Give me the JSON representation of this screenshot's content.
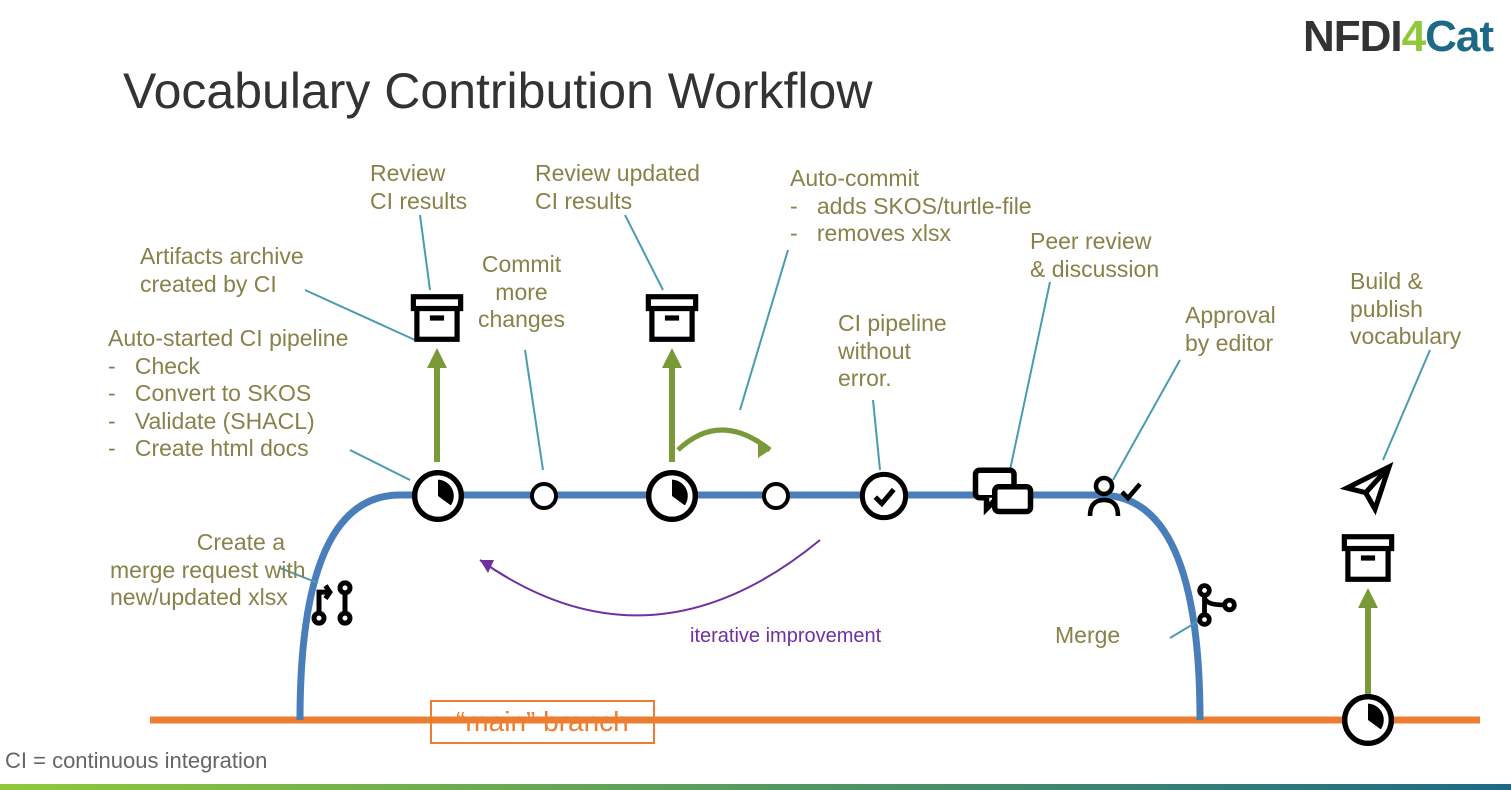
{
  "title": "Vocabulary Contribution Workflow",
  "logo": {
    "part1": "NFDI",
    "part2": "4",
    "part3": "Cat"
  },
  "labels": {
    "merge_request": "Create a\nmerge request with\nnew/updated xlsx",
    "ci_pipeline": "Auto-started CI pipeline\n-   Check\n-   Convert to SKOS\n-   Validate (SHACL)\n-   Create html docs",
    "artifacts": "Artifacts archive\ncreated by CI",
    "review_ci": "Review\nCI results",
    "commit_more": "Commit\nmore\nchanges",
    "review_updated": "Review updated\nCI results",
    "auto_commit": "Auto-commit\n-   adds SKOS/turtle-file\n-   removes xlsx",
    "ci_no_error": "CI pipeline\nwithout\nerror.",
    "peer_review": "Peer review\n& discussion",
    "approval": "Approval\nby editor",
    "merge": "Merge",
    "build_publish": "Build &\npublish\nvocabulary",
    "iterative": "iterative improvement",
    "main_branch": "“main” branch",
    "footnote": "CI = continuous integration"
  }
}
